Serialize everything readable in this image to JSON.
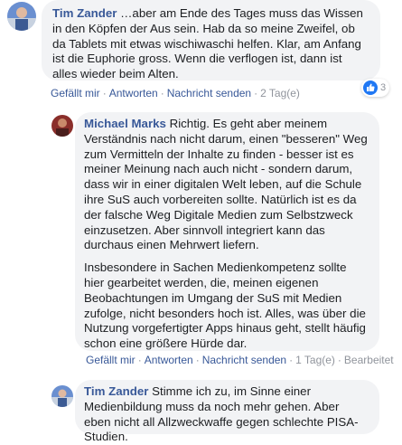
{
  "comments": [
    {
      "author": "Tim Zander",
      "text": " …aber am Ende des Tages muss das Wissen in den Köpfen der Aus sein. Hab da so meine Zweifel, ob da Tablets mit etwas wischiwaschi helfen. Klar, am Anfang ist die Euphorie gross. Wenn die verflogen ist, dann ist alles wieder beim Alten.",
      "actions": {
        "like": "Gefällt mir",
        "reply": "Antworten",
        "message": "Nachricht senden",
        "time": "2 Tag(e)"
      },
      "reaction_count": "3"
    },
    {
      "author": "Michael Marks",
      "text": " Richtig. Es geht aber meinem Verständnis nach nicht darum, einen \"besseren\" Weg zum Vermitteln der Inhalte zu finden - besser ist es meiner Meinung nach auch nicht - sondern darum, dass wir in einer digitalen Welt leben, auf die Schule ihre SuS auch vorbereiten sollte. Natürlich ist es da der falsche Weg Digitale Medien zum Selbstzweck einzusetzen. Aber sinnvoll integriert kann das durchaus einen Mehrwert liefern.",
      "text2": "Insbesondere in Sachen Medienkompetenz sollte hier gearbeitet werden, die, meinen eigenen Beobachtungen im Umgang der SuS mit Medien zufolge, nicht besonders hoch ist. Alles, was über die Nutzung vorgefertigter Apps hinaus geht, stellt häufig schon eine größere Hürde dar.",
      "actions": {
        "like": "Gefällt mir",
        "reply": "Antworten",
        "message": "Nachricht senden",
        "time": "1 Tag(e)",
        "edited": "Bearbeitet"
      }
    },
    {
      "author": "Tim Zander",
      "text": " Stimme ich zu, im Sinne einer Medienbildung muss da noch mehr gehen. Aber eben nicht all Allzweckwaffe gegen schlechte PISA-Studien."
    }
  ],
  "colors": {
    "link": "#385898",
    "bubble": "#f2f3f5",
    "like_blue": "#2078f4"
  },
  "icons": [
    "avatar-tim-zander",
    "avatar-michael-marks",
    "like-icon"
  ]
}
